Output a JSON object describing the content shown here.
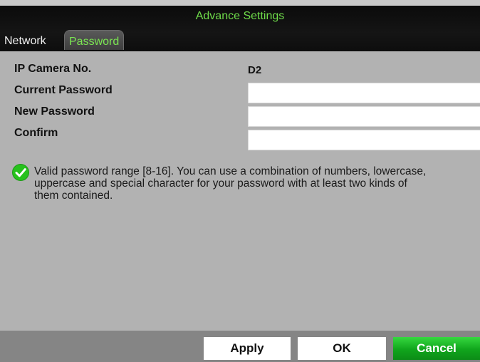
{
  "window": {
    "title": "Advance Settings"
  },
  "tabs": [
    {
      "label": "Network",
      "active": false
    },
    {
      "label": "Password",
      "active": true
    }
  ],
  "form": {
    "camera_label": "IP Camera No.",
    "camera_value": "D2",
    "current_password_label": "Current Password",
    "current_password_value": "",
    "new_password_label": "New Password",
    "new_password_value": "",
    "confirm_label": "Confirm",
    "confirm_value": ""
  },
  "hint": {
    "icon": "check-circle-icon",
    "text": "Valid password range [8-16]. You can use a combination of numbers, lowercase, uppercase and special character for your password with at least two kinds of them contained."
  },
  "buttons": {
    "apply": "Apply",
    "ok": "OK",
    "cancel": "Cancel"
  },
  "colors": {
    "title_text": "#6fdc4a",
    "active_tab_text": "#7be552",
    "panel_background": "#b2b2b2",
    "footer_background": "#858585",
    "cancel_button": "#10a51c",
    "check_icon": "#27c21d"
  }
}
